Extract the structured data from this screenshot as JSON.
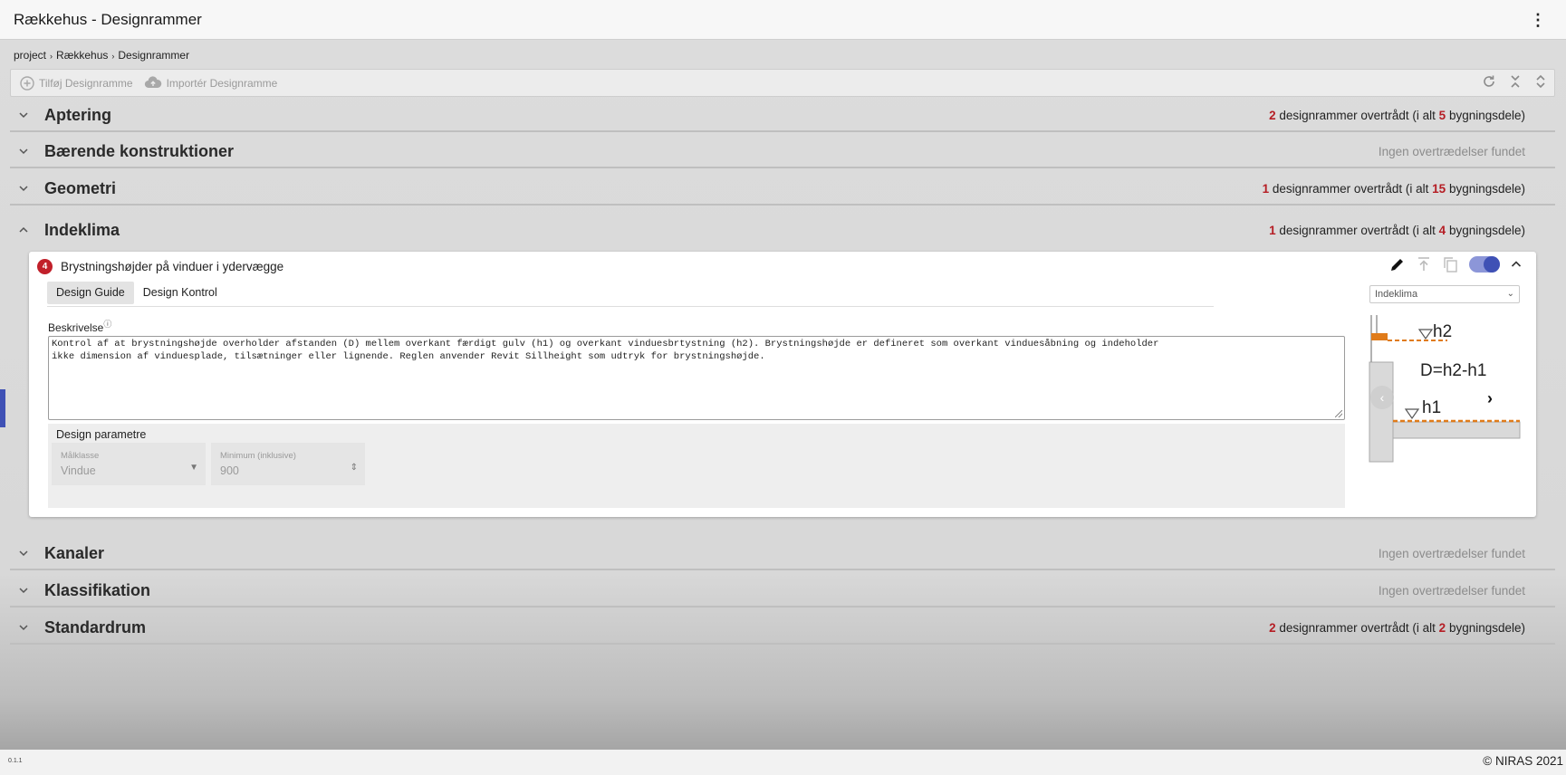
{
  "app": {
    "title": "Rækkehus - Designrammer",
    "menu_glyph": "⋮"
  },
  "breadcrumb": [
    "project",
    "Rækkehus",
    "Designrammer"
  ],
  "toolbar": {
    "add_label": "Tilføj Designramme",
    "import_label": "Importér Designramme"
  },
  "sections": [
    {
      "name": "Aptering",
      "count": "2",
      "mid": " designrammer overtrådt (i alt ",
      "total": "5",
      "end": " bygningsdele)"
    },
    {
      "name": "Bærende konstruktioner",
      "none": "Ingen overtrædelser fundet"
    },
    {
      "name": "Geometri",
      "count": "1",
      "mid": " designrammer overtrådt (i alt ",
      "total": "15",
      "end": " bygningsdele)"
    },
    {
      "name": "Indeklima",
      "count": "1",
      "mid": " designrammer overtrådt (i alt ",
      "total": "4",
      "end": " bygningsdele)"
    },
    {
      "name": "Kanaler",
      "none": "Ingen overtrædelser fundet"
    },
    {
      "name": "Klassifikation",
      "none": "Ingen overtrædelser fundet"
    },
    {
      "name": "Standardrum",
      "count": "2",
      "mid": " designrammer overtrådt (i alt ",
      "total": "2",
      "end": " bygningsdele)"
    }
  ],
  "card": {
    "badge": "4",
    "title": "Brystningshøjder på vinduer i ydervægge",
    "tabs": [
      "Design Guide",
      "Design Kontrol"
    ],
    "category_select": "Indeklima",
    "description_label": "Beskrivelse",
    "info_glyph": "ⓘ",
    "description_lines": [
      "Kontrol af at brystningshøjde overholder afstanden (D) mellem overkant færdigt gulv (h1) og overkant vinduesbrtystning (h2). Brystningshøjde er defineret som overkant vinduesåbning og indeholder",
      "ikke dimension af vinduesplade, tilsætninger eller lignende. Reglen anvender Revit Sillheight som udtryk for brystningshøjde."
    ],
    "params_title": "Design parametre",
    "fields": [
      {
        "label": "Målklasse",
        "value": "Vindue"
      },
      {
        "label": "Minimum (inklusive)",
        "value": "900"
      }
    ],
    "diagram": {
      "h2": "h2",
      "formula": "D=h2-h1",
      "h1": "h1",
      "accent_color": "#e07b1a"
    }
  },
  "footer": {
    "version": "0.1.1",
    "copyright": "© NIRAS 2021"
  },
  "colors": {
    "violation_red": "#b51d24",
    "toggle_blue": "#3f51b5"
  }
}
